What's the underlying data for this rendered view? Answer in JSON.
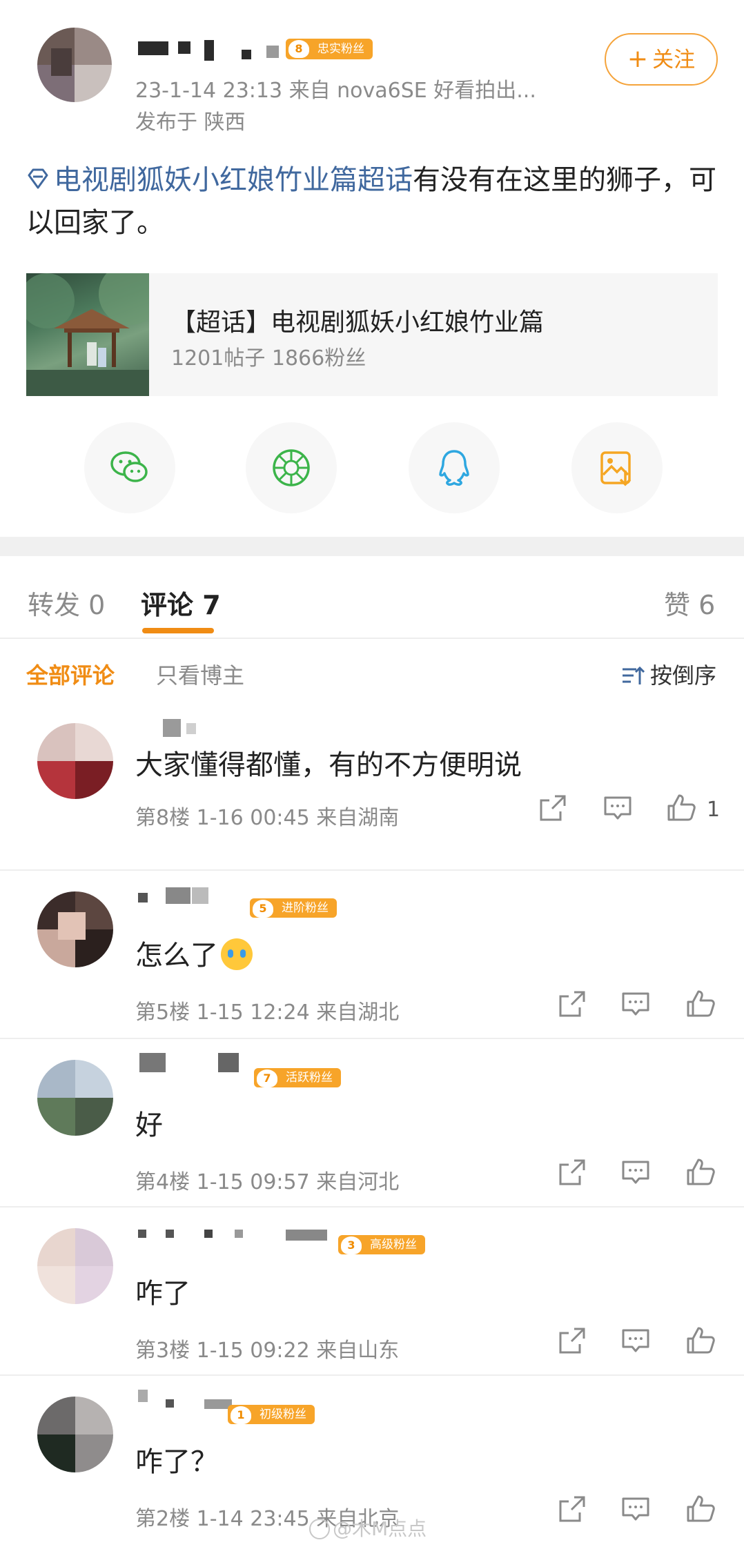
{
  "post": {
    "fan_badge": {
      "level": "8",
      "label": "忠实粉丝"
    },
    "meta": "23-1-14 23:13  来自 nova6SE 好看拍出...",
    "location": "发布于 陕西",
    "follow_label": "关注",
    "text_topic": "电视剧狐妖小红娘竹业篇超话",
    "text_body": "有没有在这里的狮子，可以回家了。",
    "topic_card": {
      "title": "【超话】电视剧狐妖小红娘竹业篇",
      "stats": "1201帖子 1866粉丝"
    },
    "share_icons": [
      "wechat-icon",
      "moments-icon",
      "qq-icon",
      "save-image-icon"
    ]
  },
  "tabs": {
    "repost": "转发 0",
    "comment": "评论 7",
    "like": "赞 6"
  },
  "filters": {
    "all": "全部评论",
    "author_only": "只看博主",
    "sort": "按倒序"
  },
  "comments": [
    {
      "badge": null,
      "text": "大家懂得都懂，有的不方便明说",
      "meta": "第8楼  1-16 00:45  来自湖南",
      "likes": "1"
    },
    {
      "badge": {
        "level": "5",
        "label": "进阶粉丝"
      },
      "text": "怎么了",
      "meta": "第5楼  1-15 12:24  来自湖北",
      "likes": ""
    },
    {
      "badge": {
        "level": "7",
        "label": "活跃粉丝"
      },
      "text": "好",
      "meta": "第4楼  1-15 09:57  来自河北",
      "likes": ""
    },
    {
      "badge": {
        "level": "3",
        "label": "高级粉丝"
      },
      "text": "咋了",
      "meta": "第3楼  1-15 09:22  来自山东",
      "likes": ""
    },
    {
      "badge": {
        "level": "1",
        "label": "初级粉丝"
      },
      "text": "咋了？",
      "meta": "第2楼  1-14 23:45  来自北京",
      "likes": ""
    }
  ],
  "colors": {
    "accent": "#f08c14",
    "link": "#40689e",
    "muted": "#8a8a8a",
    "badge": "#f7a429"
  },
  "watermark": "@木M点点"
}
